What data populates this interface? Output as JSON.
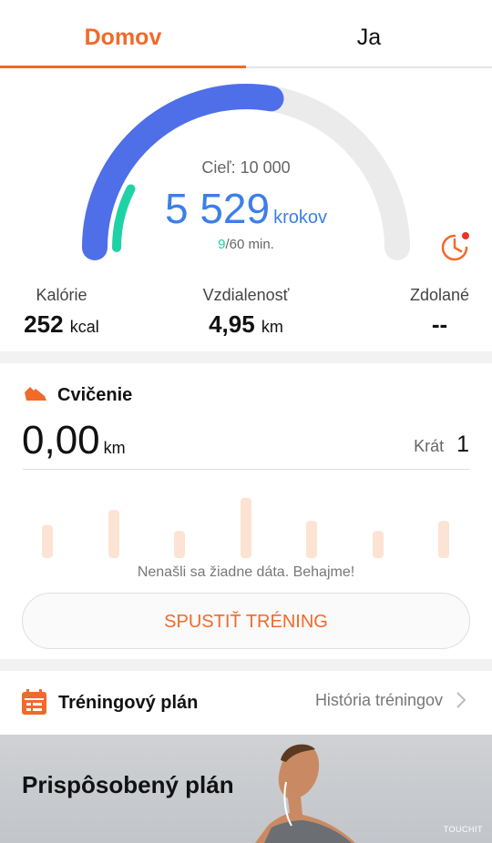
{
  "tabs": {
    "home": "Domov",
    "me": "Ja"
  },
  "summary": {
    "goal": "Cieľ: 10 000",
    "steps": "5 529",
    "steps_unit": "krokov",
    "active_minutes": "9",
    "minutes_rest": "/60 min.",
    "steps_progress": 0.5529,
    "minutes_progress": 0.15,
    "colors": {
      "steps": "#4f6fe8",
      "minutes": "#1fd2a6",
      "track": "#ebebeb"
    },
    "history_icon": "pie-chart-history-icon"
  },
  "stats": {
    "calories": {
      "label": "Kalórie",
      "value": "252",
      "unit": "kcal"
    },
    "distance": {
      "label": "Vzdialenosť",
      "value": "4,95",
      "unit": "km"
    },
    "climbed": {
      "label": "Zdolané",
      "value": "--"
    }
  },
  "exercise": {
    "title": "Cvičenie",
    "icon": "running-shoe-icon",
    "distance": "0,00",
    "distance_unit": "km",
    "count_label": "Krát",
    "count": "1",
    "no_data": "Nenašli sa žiadne dáta. Behajme!",
    "start_button": "SPUSTIŤ TRÉNING",
    "placeholder_bars": [
      0.55,
      0.8,
      0.45,
      1.0,
      0.62,
      0.45,
      0.62
    ],
    "accent": "#f06a2a"
  },
  "plan": {
    "title": "Tréningový plán",
    "history_link": "História tréningov",
    "icon": "calendar-icon"
  },
  "banner": {
    "title": "Prispôsobený plán",
    "watermark": "TOUCHIT"
  }
}
